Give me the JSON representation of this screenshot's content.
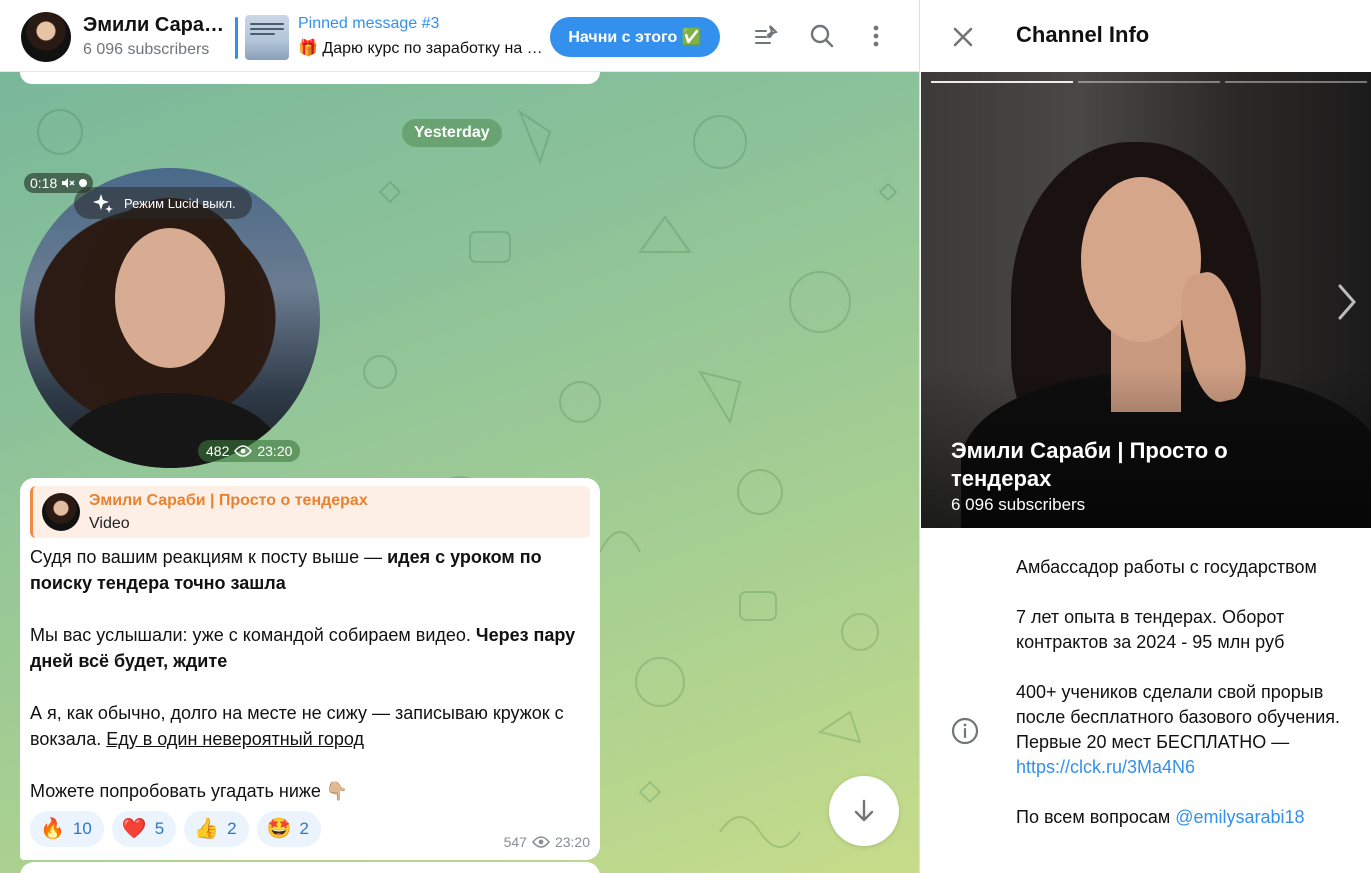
{
  "header": {
    "channel_title": "Эмили Сараби | Просто о тендерах",
    "subscribers": "6 096 subscribers",
    "pinned_title": "Pinned message #3",
    "pinned_text": "🎁 Дарю курс по заработку на тендерах",
    "cta_label": "Начни с этого ✅",
    "icons": [
      "pin-list-icon",
      "search-icon",
      "more-vertical-icon"
    ]
  },
  "chat": {
    "date_label": "Yesterday",
    "video": {
      "duration": "0:18",
      "lucid_label": "Режим Lucid выкл.",
      "views": "482",
      "time": "23:20"
    },
    "message": {
      "reply_name": "Эмили Сараби | Просто о тендерах",
      "reply_type": "Video",
      "p1_plain": "Судя по вашим реакциям к посту выше — ",
      "p1_bold": "идея с уроком по поиску тендера точно зашла",
      "p2_plain": "Мы вас услышали: уже с командой собираем видео. ",
      "p2_bold": "Через пару дней всё будет, ждите",
      "p3_plain": "А я, как обычно, долго на месте не сижу — записываю кружок с вокзала. ",
      "p3_link": "Еду в один невероятный город",
      "p4": "Можете попробовать угадать ниже 👇🏼",
      "reactions": [
        {
          "emoji": "🔥",
          "count": "10"
        },
        {
          "emoji": "❤️",
          "count": "5"
        },
        {
          "emoji": "👍",
          "count": "2"
        },
        {
          "emoji": "🤩",
          "count": "2"
        }
      ],
      "views": "547",
      "time": "23:20"
    }
  },
  "info": {
    "title": "Channel Info",
    "name": "Эмили Сараби | Просто о тендерах",
    "subscribers": "6 096 subscribers",
    "desc_p1": "Амбассадор работы с государством",
    "desc_p2": "7 лет опыта в тендерах. Оборот контрактов за 2024 - 95 млн руб",
    "desc_p3_plain": "400+ учеников сделали свой прорыв после бесплатного базового обучения. Первые 20 мест БЕСПЛАТНО — ",
    "desc_p3_link": "https://clck.ru/3Ma4N6",
    "desc_p4_plain": "По всем вопросам ",
    "desc_p4_link": "@emilysarabi18"
  }
}
